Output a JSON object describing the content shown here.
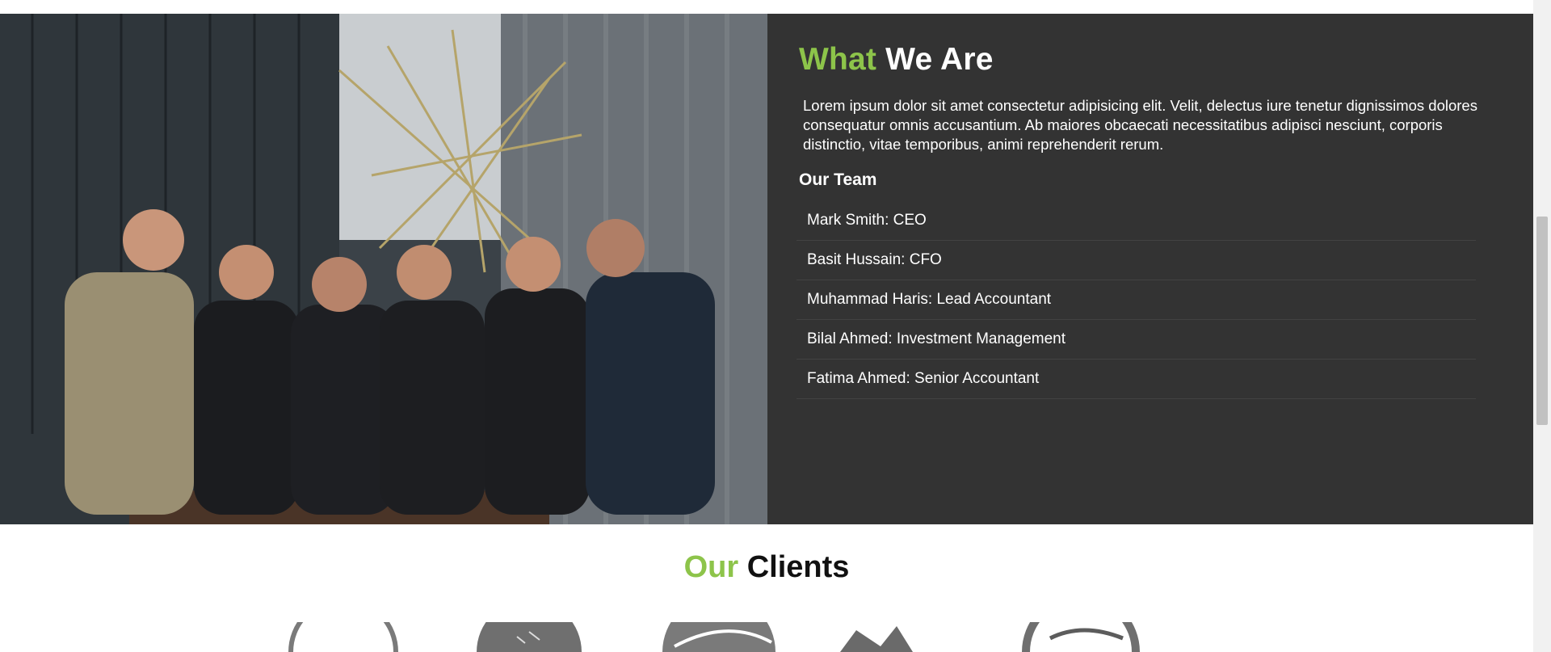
{
  "about": {
    "title_accent": "What",
    "title_rest": "We Are",
    "description": "Lorem ipsum dolor sit amet consectetur adipisicing elit. Velit, delectus iure tenetur dignissimos dolores consequatur omnis accusantium. Ab maiores obcaecati necessitatibus adipisci nesciunt, corporis distinctio, vitae temporibus, animi reprehenderit rerum.",
    "team_heading": "Our Team",
    "team": [
      "Mark Smith: CEO",
      "Basit Hussain: CFO",
      "Muhammad Haris: Lead Accountant",
      "Bilal Ahmed: Investment Management",
      "Fatima Ahmed: Senior Accountant"
    ]
  },
  "clients": {
    "title_accent": "Our",
    "title_rest": "Clients"
  },
  "colors": {
    "accent": "#8dc44a",
    "dark_panel": "#333333",
    "divider": "#424242"
  },
  "icons": [
    "team-photo",
    "client-logo-1",
    "client-logo-2",
    "client-logo-3",
    "client-logo-4",
    "client-logo-5"
  ]
}
